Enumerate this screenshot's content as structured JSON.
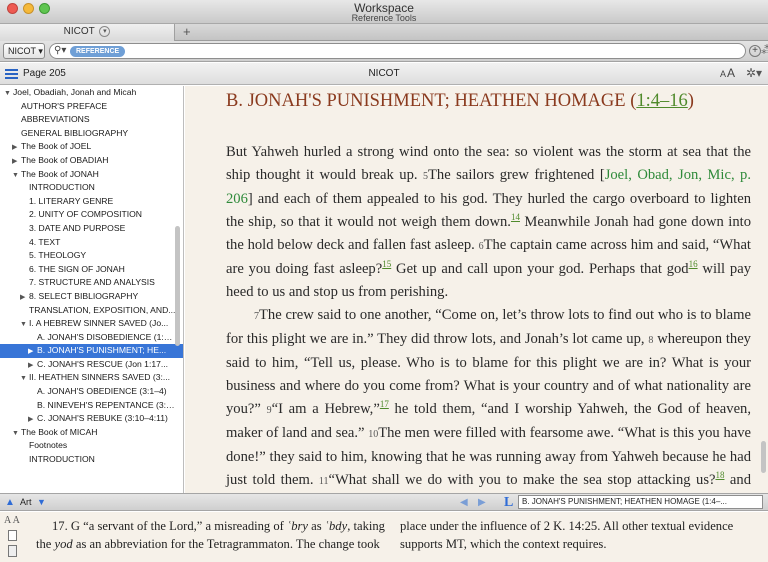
{
  "window": {
    "title": "Workspace",
    "subtitle": "Reference Tools"
  },
  "tab": {
    "label": "NICOT",
    "chevron": "▾",
    "add": "+"
  },
  "search": {
    "resource": "NICOT",
    "resource_arrow": "▾",
    "type_pill": "REFERENCE",
    "value": "",
    "add_icon": "+"
  },
  "panel": {
    "page": "Page 205",
    "title": "NICOT",
    "font_small": "A",
    "font_big": "A"
  },
  "toc": [
    {
      "label": "Joel, Obadiah, Jonah and Micah",
      "tri": "▼",
      "level": 0
    },
    {
      "label": "AUTHOR'S PREFACE",
      "tri": "",
      "level": 1
    },
    {
      "label": "ABBREVIATIONS",
      "tri": "",
      "level": 1
    },
    {
      "label": "GENERAL BIBLIOGRAPHY",
      "tri": "",
      "level": 1
    },
    {
      "label": "The Book of JOEL",
      "tri": "▶",
      "level": 1
    },
    {
      "label": "The Book of OBADIAH",
      "tri": "▶",
      "level": 1
    },
    {
      "label": "The Book of JONAH",
      "tri": "▼",
      "level": 1
    },
    {
      "label": "INTRODUCTION",
      "tri": "",
      "level": 2
    },
    {
      "label": "1. LITERARY GENRE",
      "tri": "",
      "level": 2
    },
    {
      "label": "2. UNITY OF COMPOSITION",
      "tri": "",
      "level": 2
    },
    {
      "label": "3. DATE AND PURPOSE",
      "tri": "",
      "level": 2
    },
    {
      "label": "4. TEXT",
      "tri": "",
      "level": 2
    },
    {
      "label": "5. THEOLOGY",
      "tri": "",
      "level": 2
    },
    {
      "label": "6. THE SIGN OF JONAH",
      "tri": "",
      "level": 2
    },
    {
      "label": "7. STRUCTURE AND ANALYSIS",
      "tri": "",
      "level": 2
    },
    {
      "label": "8. SELECT BIBLIOGRAPHY",
      "tri": "▶",
      "level": 2
    },
    {
      "label": "TRANSLATION, EXPOSITION, AND...",
      "tri": "",
      "level": 2
    },
    {
      "label": "I. A HEBREW SINNER SAVED (Jo...",
      "tri": "▼",
      "level": 2
    },
    {
      "label": "A. JONAH'S DISOBEDIENCE (1:1–3)",
      "tri": "",
      "level": 3
    },
    {
      "label": "B. JONAH'S PUNISHMENT; HE...",
      "tri": "▶",
      "level": 3
    },
    {
      "label": "C. JONAH'S RESCUE (Jon 1:17...",
      "tri": "▶",
      "level": 3
    },
    {
      "label": "II. HEATHEN SINNERS SAVED (3:...",
      "tri": "▼",
      "level": 2
    },
    {
      "label": "A. JONAH'S OBEDIENCE (3:1–4)",
      "tri": "",
      "level": 3
    },
    {
      "label": "B. NINEVEH'S REPENTANCE (3:5...",
      "tri": "",
      "level": 3
    },
    {
      "label": "C. JONAH'S REBUKE (3:10–4:11)",
      "tri": "▶",
      "level": 3
    },
    {
      "label": "The Book of MICAH",
      "tri": "▼",
      "level": 1
    },
    {
      "label": "Footnotes",
      "tri": "",
      "level": 2
    },
    {
      "label": "INTRODUCTION",
      "tri": "",
      "level": 2
    }
  ],
  "toc_selected_index": 19,
  "article": {
    "heading": "B. JONAH'S PUNISHMENT; HEATHEN HOMAGE",
    "heading_ref": "1:4–16"
  },
  "bottom": {
    "art_label": "Art",
    "link_letter": "L",
    "link_value": "B. JONAH'S PUNISHMENT; HEATHEN HOMAGE (1:4–..."
  },
  "footnote": {
    "aa": "A A"
  },
  "colors": {
    "accent": "#3875d7",
    "heading": "#8a3a1e",
    "link": "#4f8a2b",
    "paper": "#f6f1e9"
  }
}
